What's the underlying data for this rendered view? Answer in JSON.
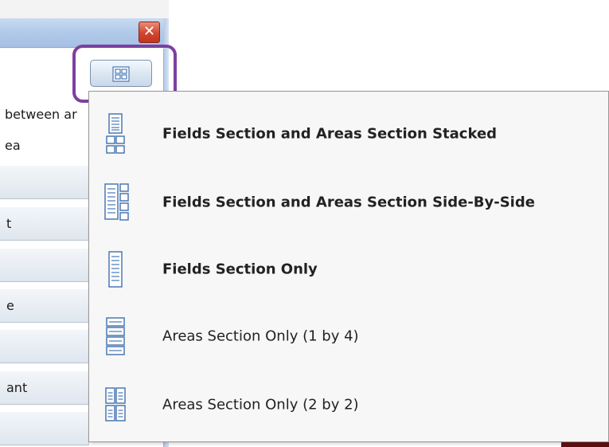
{
  "window": {
    "close_glyph": "✕",
    "description_lines": [
      "between ar",
      "ea"
    ],
    "list_buttons": [
      "",
      "t",
      "",
      "e",
      "",
      "ant",
      ""
    ]
  },
  "layout_button": {
    "icon": "grid-layout-icon"
  },
  "menu": {
    "items": [
      {
        "label": "Fields Section and Areas Section Stacked",
        "icon": "stacked-layout-icon",
        "bold": true
      },
      {
        "label": "Fields Section and Areas Section Side-By-Side",
        "icon": "side-by-side-layout-icon",
        "bold": true
      },
      {
        "label": "Fields Section Only",
        "icon": "fields-only-layout-icon",
        "bold": true
      },
      {
        "label": "Areas Section Only (1 by 4)",
        "icon": "areas-1-by-4-layout-icon",
        "bold": false
      },
      {
        "label": "Areas Section Only (2 by 2)",
        "icon": "areas-2-by-2-layout-icon",
        "bold": false
      }
    ]
  },
  "colors": {
    "highlight": "#7d3fa0",
    "icon_stroke": "#4a78b4",
    "icon_fill": "#ffffff"
  }
}
